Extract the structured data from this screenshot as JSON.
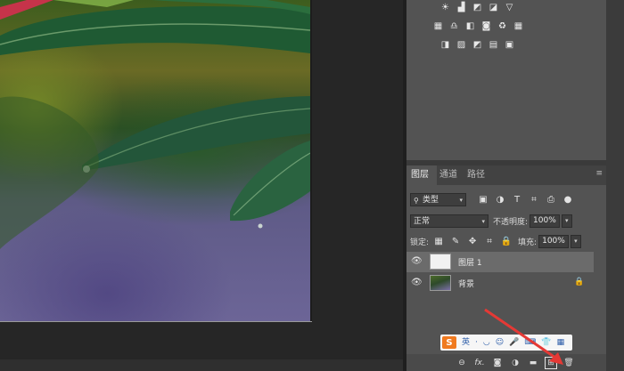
{
  "canvas": {
    "photo_icon": "leaf-photo"
  },
  "adjustments": {
    "rows": [
      [
        "brightness-icon",
        "levels-icon",
        "curves-icon",
        "exposure-icon",
        "gradient-triangle-icon"
      ],
      [
        "vibrance-icon",
        "balance-icon",
        "bw-icon",
        "photo-filter-icon",
        "mixer-icon",
        "lookup-icon"
      ],
      [
        "invert-icon",
        "posterize-icon",
        "threshold-icon",
        "gradient-map-icon",
        "selective-color-icon"
      ]
    ]
  },
  "layers_panel": {
    "tabs": [
      {
        "label": "图层",
        "active": true
      },
      {
        "label": "通道",
        "active": false
      },
      {
        "label": "路径",
        "active": false
      }
    ],
    "filter": {
      "kind_label": "类型",
      "icons": [
        "pixel-filter-icon",
        "adjust-filter-icon",
        "type-filter-icon",
        "shape-filter-icon",
        "smart-filter-icon",
        "filter-toggle-icon"
      ]
    },
    "blend": {
      "mode": "正常",
      "opacity_label": "不透明度:",
      "opacity_value": "100%"
    },
    "lock": {
      "label": "锁定:",
      "fill_label": "填充:",
      "fill_value": "100%"
    },
    "layers": [
      {
        "name": "图层 1",
        "selected": true,
        "visible": true,
        "locked": false
      },
      {
        "name": "背景",
        "selected": false,
        "visible": true,
        "locked": true
      }
    ],
    "bottom_icons": [
      "link-icon",
      "fx-icon",
      "mask-icon",
      "adjustment-layer-icon",
      "group-folder-icon",
      "new-layer-icon",
      "trash-icon"
    ],
    "bottom_fx_label": "fx."
  },
  "ime": {
    "logo": "S",
    "mode": "英",
    "items": [
      "·",
      "◡",
      "☺",
      "🎤",
      "⌨",
      "👕",
      "▦"
    ]
  },
  "colors": {
    "panel_bg": "#535353",
    "selected_row": "#6b6b6b",
    "annotation_arrow": "#e53935"
  }
}
